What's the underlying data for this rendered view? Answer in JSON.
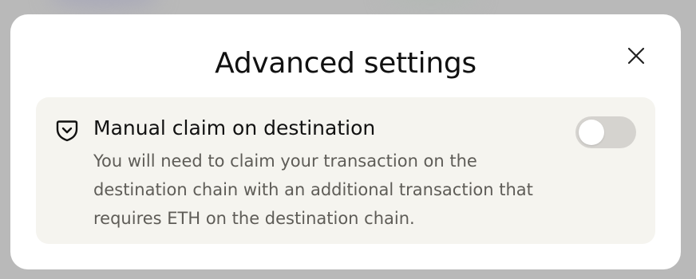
{
  "modal": {
    "title": "Advanced settings",
    "close_icon": "close-icon"
  },
  "setting": {
    "icon": "shield-icon",
    "title": "Manual claim on destination",
    "description": "You will need to claim your transaction on the destination chain with an additional transaction that requires ETH on the destination chain.",
    "enabled": false
  },
  "colors": {
    "card_background": "#f5f4ef",
    "toggle_off": "#d5d3cf",
    "text_primary": "#111111",
    "text_secondary": "#5e5c57"
  }
}
